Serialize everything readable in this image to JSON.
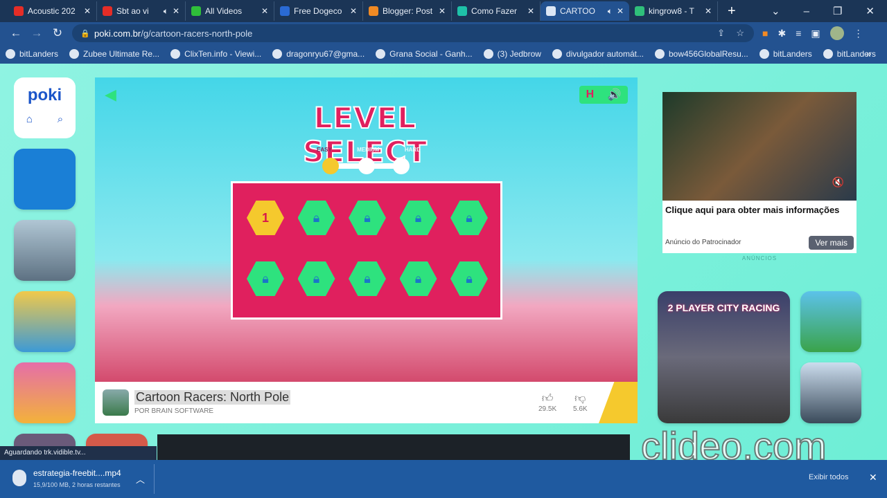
{
  "browser": {
    "tabs": [
      {
        "title": "Acoustic 202",
        "icon": "youtube-icon",
        "color": "#e52d27"
      },
      {
        "title": "Sbt ao vi",
        "icon": "youtube-icon",
        "color": "#e52d27",
        "audio": true
      },
      {
        "title": "All Videos",
        "icon": "play-icon",
        "color": "#2fbf3a"
      },
      {
        "title": "Free Dogeco",
        "icon": "drop-icon",
        "color": "#2a6ad4"
      },
      {
        "title": "Blogger: Post",
        "icon": "blogger-icon",
        "color": "#f08a24"
      },
      {
        "title": "Como Fazer",
        "icon": "play-icon",
        "color": "#1ec1a8"
      },
      {
        "title": "CARTOO",
        "icon": "poki-icon",
        "color": "#dbe6f5",
        "audio": true,
        "active": true
      },
      {
        "title": "kingrow8 - T",
        "icon": "clover-icon",
        "color": "#2fbf7a"
      }
    ],
    "url_host": "poki.com.br",
    "url_path": "/g/cartoon-racers-north-pole",
    "bookmarks": [
      "bitLanders",
      "Zubee Ultimate Re...",
      "ClixTen.info - Viewi...",
      "dragonryu67@gma...",
      "Grana Social - Ganh...",
      "(3) Jedbrow",
      "divulgador automát...",
      "bow456GlobalResu...",
      "bitLanders",
      "bitLanders"
    ],
    "status_text": "Aguardando trk.vidible.tv...",
    "download": {
      "filename": "estrategia-freebit....mp4",
      "progress": "15,9/100 MB, 2 horas restantes",
      "show_all": "Exibir todos"
    }
  },
  "site": {
    "logo": "poki"
  },
  "game": {
    "heading": "LEVEL SELECT",
    "difficulties": [
      "EASY",
      "MEDIUM",
      "HARD"
    ],
    "selected_difficulty": "EASY",
    "levels_unlocked": 1,
    "levels_total": 10,
    "hud": "H",
    "title": "Cartoon Racers: North Pole",
    "developer": "POR BRAIN SOFTWARE",
    "likes": "29.5K",
    "dislikes": "5.6K"
  },
  "ad": {
    "headline": "Clique aqui para obter mais informações",
    "sponsor": "Anúncio do Patrocinador",
    "cta": "Ver mais",
    "label": "ANÚNCIOS"
  },
  "related": {
    "featured_title": "2 PLAYER CITY RACING"
  },
  "watermark": "clideo.com",
  "colors": {
    "accent": "#e0205e",
    "level_locked": "#2ee27e",
    "level_open": "#f5c92d",
    "page_bg": "#7cf0dc",
    "chrome": "#235290"
  }
}
